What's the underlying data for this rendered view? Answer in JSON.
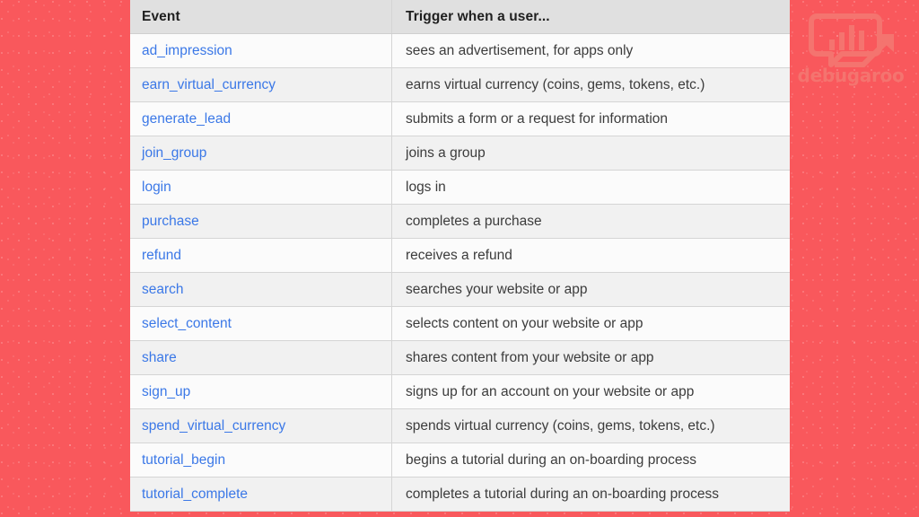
{
  "background": {
    "color": "#f9585c"
  },
  "brand": {
    "name": "debugaroo",
    "logo_icon": "speech-bubble-bar-chart-arrow-icon",
    "color": "#f4746f"
  },
  "table": {
    "columns": [
      "Event",
      "Trigger when a user..."
    ],
    "link_color": "#3b78e7",
    "text_color": "#3c3c3c",
    "header_bg": "#e0e0e0",
    "rows": [
      {
        "event": "ad_impression",
        "trigger": "sees an advertisement, for apps only"
      },
      {
        "event": "earn_virtual_currency",
        "trigger": "earns virtual currency (coins, gems, tokens, etc.)"
      },
      {
        "event": "generate_lead",
        "trigger": "submits a form or a request for information"
      },
      {
        "event": "join_group",
        "trigger": "joins a group"
      },
      {
        "event": "login",
        "trigger": "logs in"
      },
      {
        "event": "purchase",
        "trigger": "completes a purchase"
      },
      {
        "event": "refund",
        "trigger": "receives a refund"
      },
      {
        "event": "search",
        "trigger": "searches your website or app"
      },
      {
        "event": "select_content",
        "trigger": "selects content on your website or app"
      },
      {
        "event": "share",
        "trigger": "shares content from your website or app"
      },
      {
        "event": "sign_up",
        "trigger": "signs up for an account on your website or app"
      },
      {
        "event": "spend_virtual_currency",
        "trigger": "spends virtual currency (coins, gems, tokens, etc.)"
      },
      {
        "event": "tutorial_begin",
        "trigger": "begins a tutorial during an on-boarding process"
      },
      {
        "event": "tutorial_complete",
        "trigger": "completes a tutorial during an on-boarding process"
      }
    ]
  }
}
